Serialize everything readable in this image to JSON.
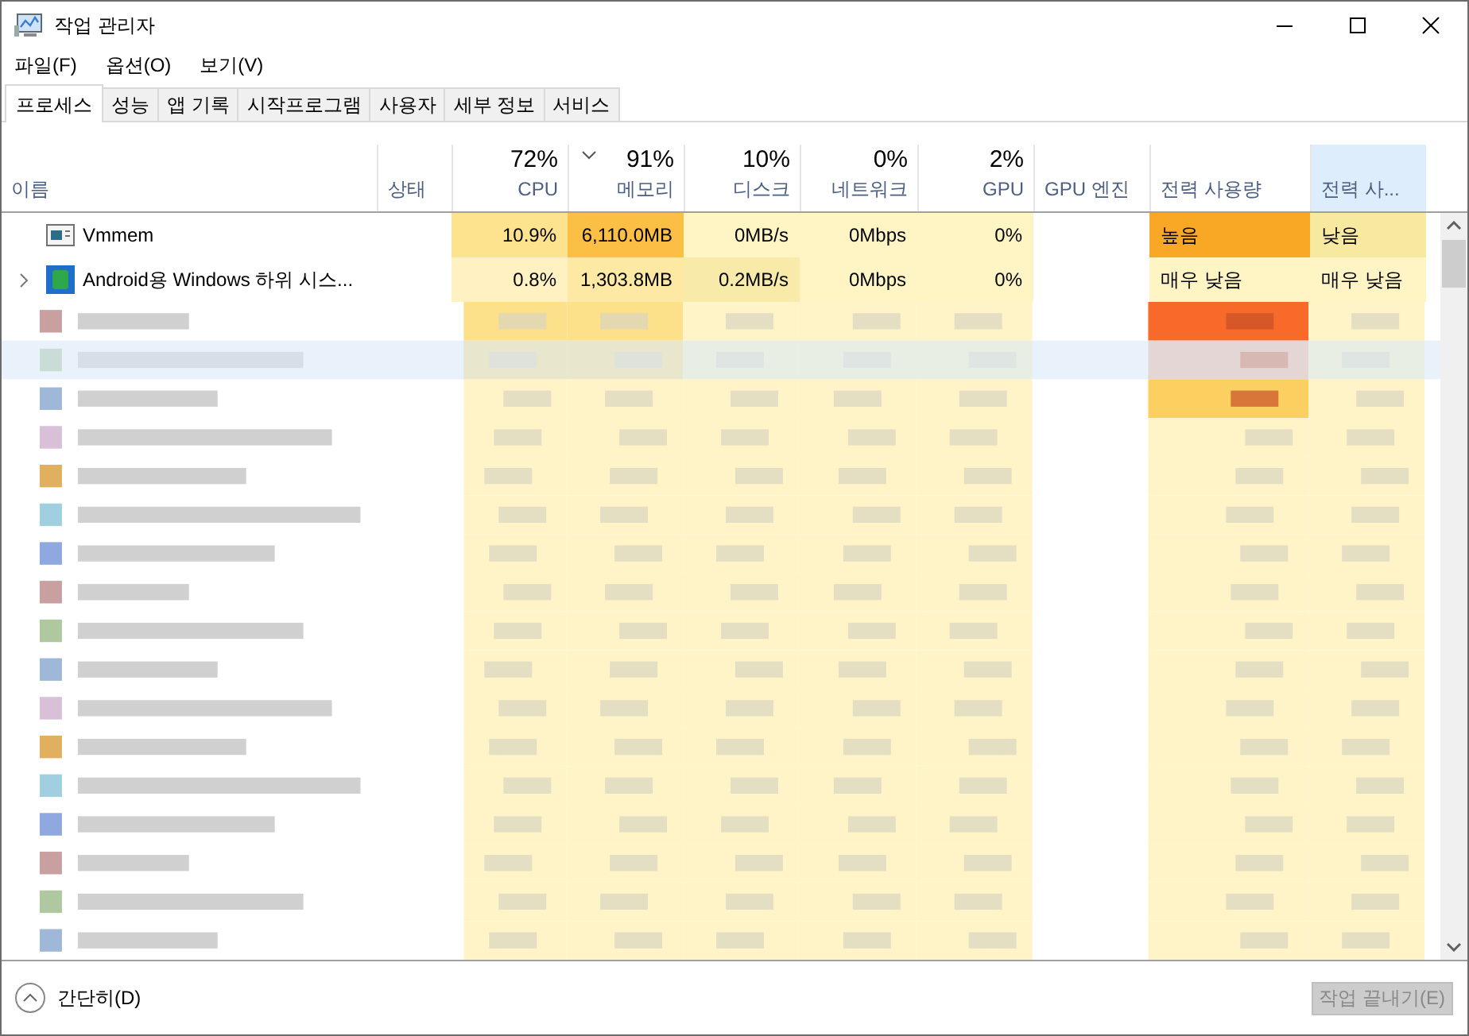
{
  "window": {
    "title": "작업 관리자"
  },
  "menu": [
    "파일(F)",
    "옵션(O)",
    "보기(V)"
  ],
  "tabs": [
    {
      "label": "프로세스",
      "selected": true
    },
    {
      "label": "성능",
      "selected": false
    },
    {
      "label": "앱 기록",
      "selected": false
    },
    {
      "label": "시작프로그램",
      "selected": false
    },
    {
      "label": "사용자",
      "selected": false
    },
    {
      "label": "세부 정보",
      "selected": false
    },
    {
      "label": "서비스",
      "selected": false
    }
  ],
  "table": {
    "columns": [
      {
        "label": "이름",
        "sorted": false,
        "selected": false
      },
      {
        "label": "상태",
        "sorted": false,
        "selected": false
      },
      {
        "label": "CPU",
        "total": "72%",
        "sorted": false,
        "selected": false
      },
      {
        "label": "메모리",
        "total": "91%",
        "sorted": true,
        "selected": false
      },
      {
        "label": "디스크",
        "total": "10%",
        "sorted": false,
        "selected": false
      },
      {
        "label": "네트워크",
        "total": "0%",
        "sorted": false,
        "selected": false
      },
      {
        "label": "GPU",
        "total": "2%",
        "sorted": false,
        "selected": false
      },
      {
        "label": "GPU 엔진",
        "sorted": false,
        "selected": false
      },
      {
        "label": "전력 사용량",
        "sorted": false,
        "selected": false
      },
      {
        "label": "전력 사...",
        "sorted": false,
        "selected": true
      }
    ],
    "rows": [
      {
        "name": "Vmmem",
        "expandable": false,
        "cpu": {
          "text": "10.9%",
          "color": "#fde38e"
        },
        "memory": {
          "text": "6,110.0MB",
          "color": "#fbbf45"
        },
        "disk": {
          "text": "0MB/s",
          "color": "#fff4c4"
        },
        "network": {
          "text": "0Mbps",
          "color": "#fff4c4"
        },
        "gpu": {
          "text": "0%",
          "color": "#fff4c4"
        },
        "power": {
          "text": "높음",
          "color": "#f9a825"
        },
        "power_trend": {
          "text": "낮음",
          "color": "#f8e9a1"
        }
      },
      {
        "name": "Android용 Windows 하위 시스...",
        "expandable": true,
        "cpu": {
          "text": "0.8%",
          "color": "#fff1c2"
        },
        "memory": {
          "text": "1,303.8MB",
          "color": "#fde9a3"
        },
        "disk": {
          "text": "0.2MB/s",
          "color": "#f8eaa8"
        },
        "network": {
          "text": "0Mbps",
          "color": "#fff4c4"
        },
        "gpu": {
          "text": "0%",
          "color": "#fff4c4"
        },
        "power": {
          "text": "매우 낮음",
          "color": "#fff4c4"
        },
        "power_trend": {
          "text": "매우 낮음",
          "color": "#fff4c4"
        }
      }
    ]
  },
  "footer": {
    "toggle": "간단히(D)",
    "end_task": {
      "label": "작업 끝내기(E)",
      "disabled": true
    }
  }
}
